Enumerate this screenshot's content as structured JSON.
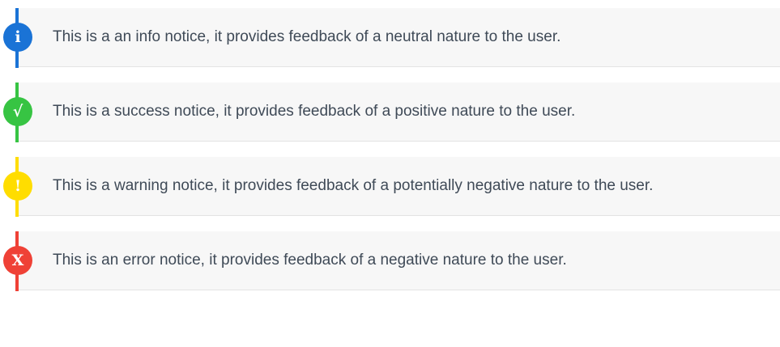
{
  "notices": [
    {
      "type": "info",
      "icon": "info-icon",
      "icon_glyph": "i",
      "color": "#1a73d6",
      "text": "This is a an info notice, it provides feedback of a neutral nature to the user."
    },
    {
      "type": "success",
      "icon": "checkmark-icon",
      "icon_glyph": "√",
      "color": "#37c443",
      "text": "This is a success notice, it provides feedback of a positive nature to the user."
    },
    {
      "type": "warning",
      "icon": "exclamation-icon",
      "icon_glyph": "!",
      "color": "#ffdd00",
      "text": "This is a warning notice, it provides feedback of a potentially negative nature to the user."
    },
    {
      "type": "error",
      "icon": "x-icon",
      "icon_glyph": "X",
      "color": "#ef4136",
      "text": "This is an error notice, it provides feedback of a negative nature to the user."
    }
  ]
}
